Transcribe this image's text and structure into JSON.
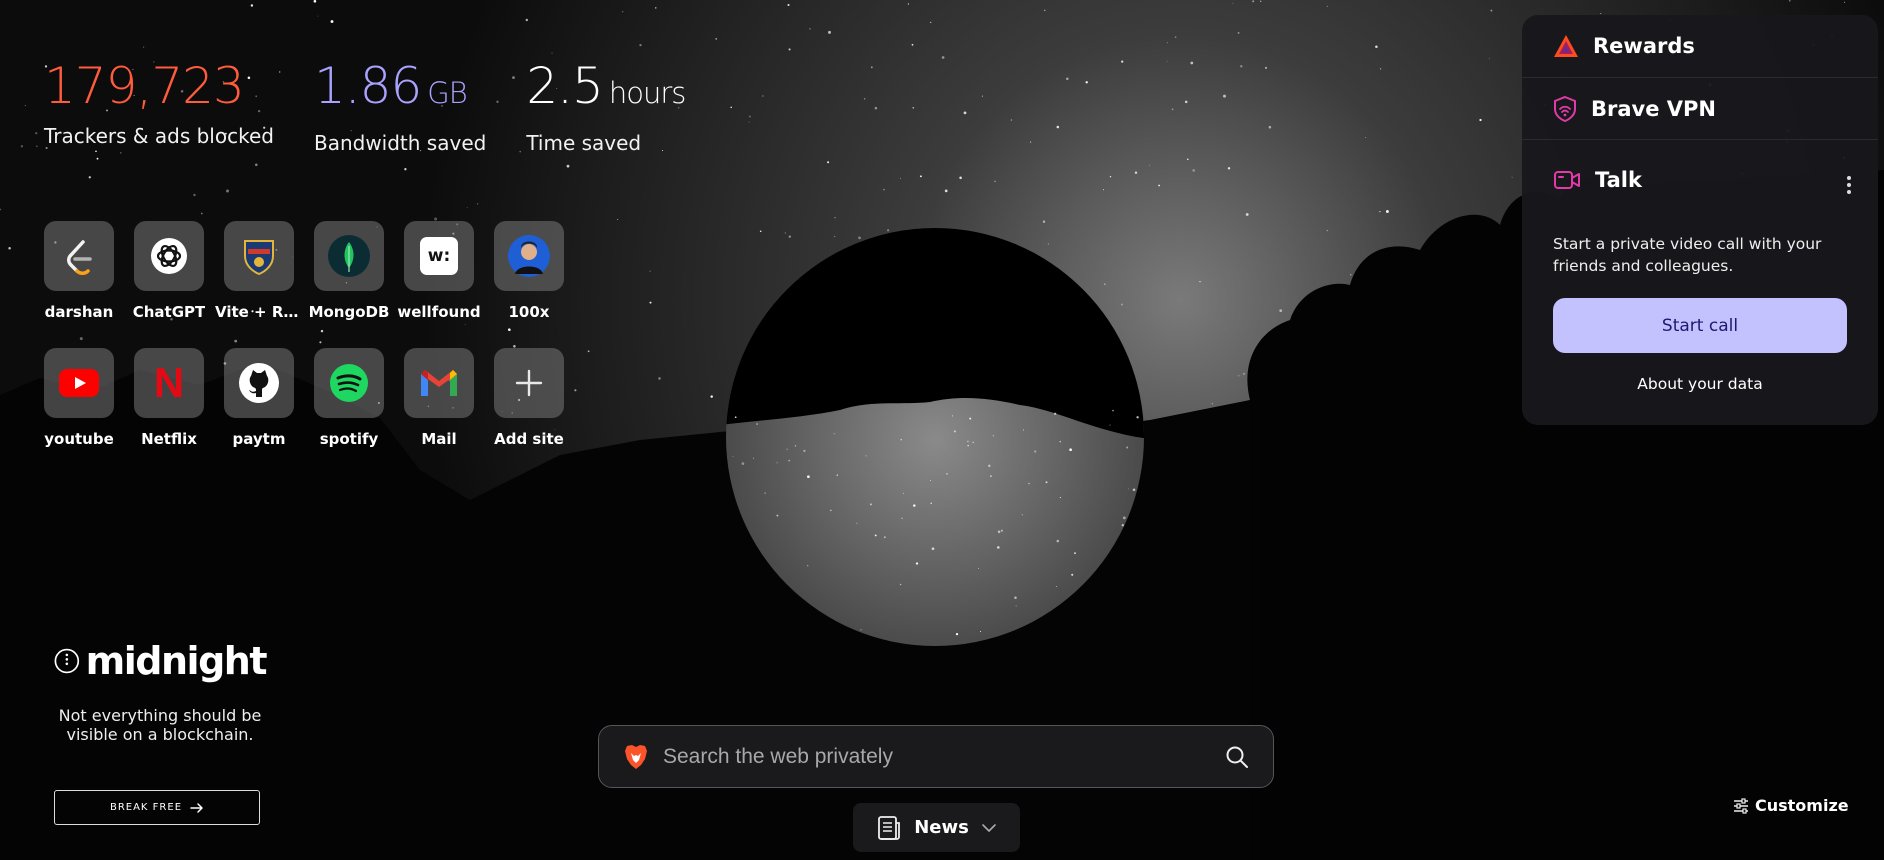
{
  "stats": {
    "trackers": {
      "value": "179,723",
      "label": "Trackers & ads blocked"
    },
    "bandwidth": {
      "value": "1.86",
      "unit": "GB",
      "label": "Bandwidth saved"
    },
    "time": {
      "value": "2.5",
      "unit": "hours",
      "label": "Time saved"
    }
  },
  "top_sites": [
    {
      "name": "darshan",
      "icon": "leetcode-icon"
    },
    {
      "name": "ChatGPT",
      "icon": "chatgpt-icon"
    },
    {
      "name": "Vite + Re...",
      "icon": "shield-badge-icon"
    },
    {
      "name": "MongoDB",
      "icon": "mongodb-leaf-icon"
    },
    {
      "name": "wellfound",
      "icon": "wellfound-icon",
      "icon_text": "w:"
    },
    {
      "name": "100x",
      "icon": "avatar-icon"
    },
    {
      "name": "youtube",
      "icon": "youtube-icon"
    },
    {
      "name": "Netflix",
      "icon": "netflix-icon",
      "icon_text": "N"
    },
    {
      "name": "paytm",
      "icon": "github-icon"
    },
    {
      "name": "spotify",
      "icon": "spotify-icon"
    },
    {
      "name": "Mail",
      "icon": "gmail-icon"
    },
    {
      "name": "Add site",
      "icon": "plus-icon"
    }
  ],
  "panel": {
    "rewards": {
      "label": "Rewards",
      "icon": "bat-triangle-icon"
    },
    "vpn": {
      "label": "Brave VPN",
      "icon": "vpn-shield-icon"
    },
    "talk": {
      "label": "Talk",
      "icon": "video-camera-icon",
      "description": "Start a private video call with your friends and colleagues.",
      "button": "Start call",
      "link": "About your data"
    }
  },
  "sponsor": {
    "brand": "midnight",
    "tagline": "Not everything should be visible on a blockchain.",
    "cta": "BREAK FREE",
    "cta_icon": "arrow-right-icon"
  },
  "search": {
    "placeholder": "Search the web privately",
    "icon": "search-icon"
  },
  "news": {
    "label": "News"
  },
  "customize": {
    "label": "Customize",
    "icon": "sliders-icon"
  },
  "colors": {
    "trackers": "#ff5c3e",
    "bandwidth": "#a9a3ff",
    "start_call_bg": "#c4c1ff",
    "panel_bg": "#18181c"
  }
}
